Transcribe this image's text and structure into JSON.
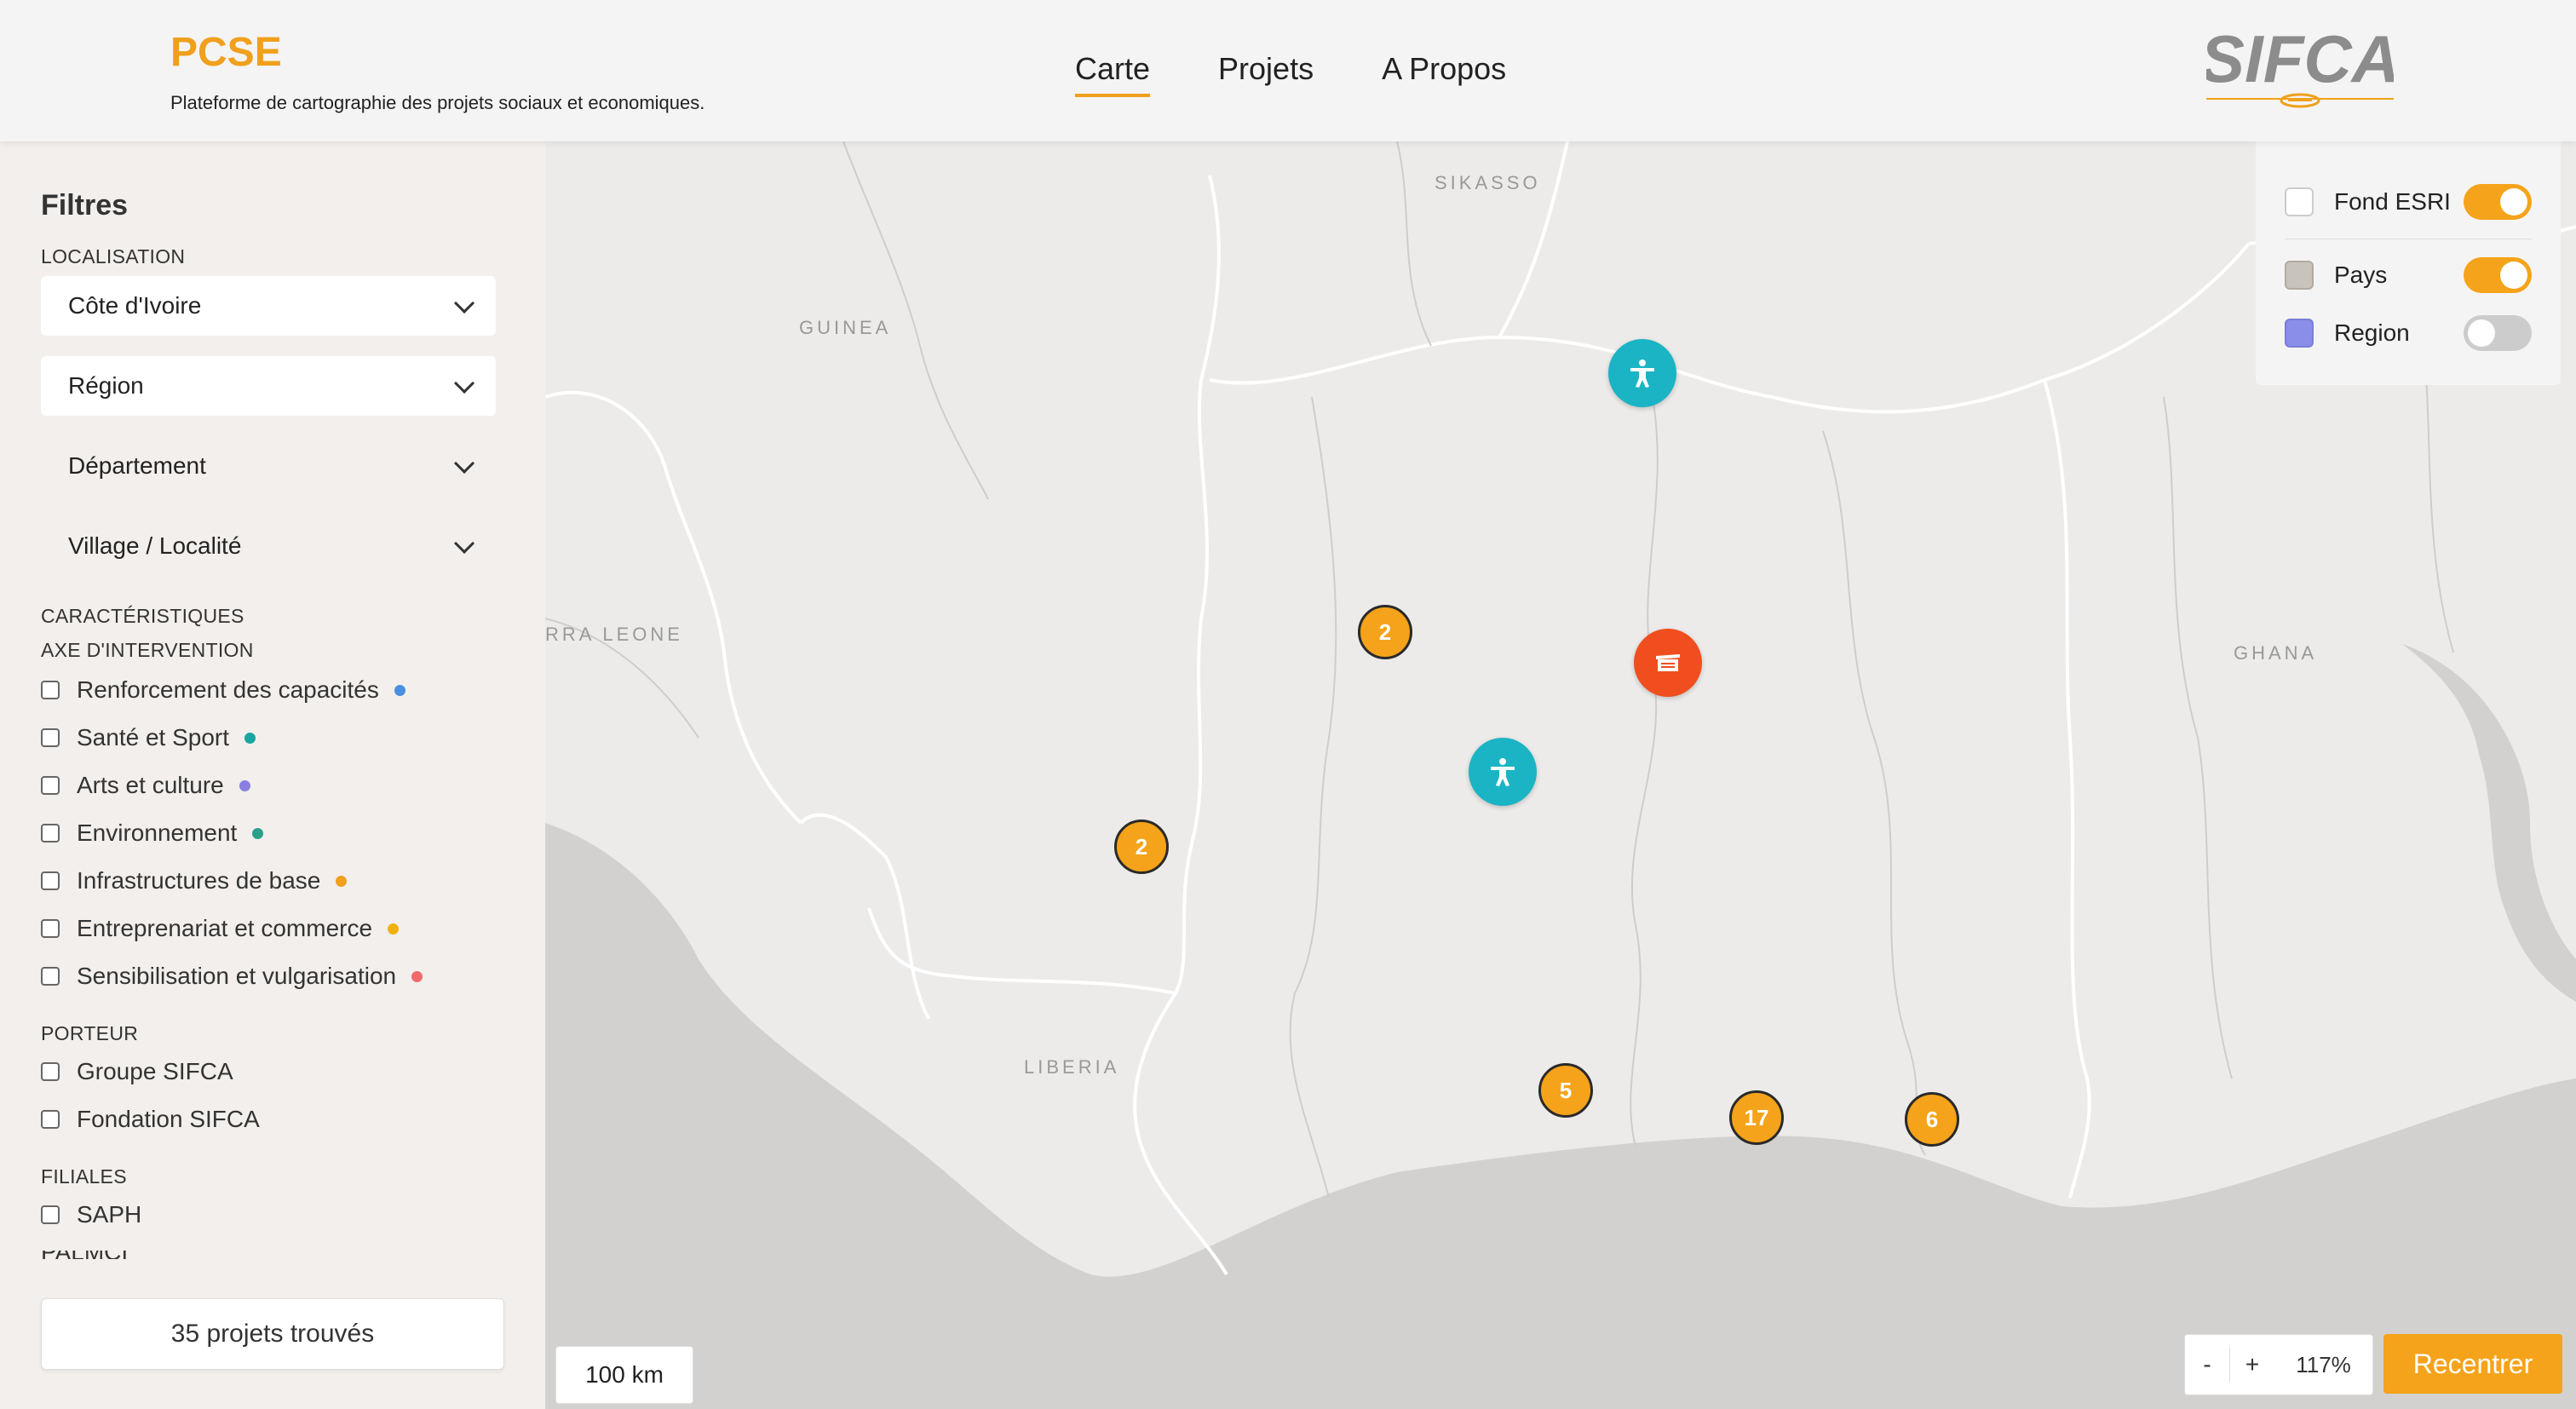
{
  "header": {
    "title": "PCSE",
    "subtitle": "Plateforme de cartographie des projets sociaux et economiques.",
    "nav": [
      {
        "label": "Carte",
        "active": true
      },
      {
        "label": "Projets",
        "active": false
      },
      {
        "label": "A Propos",
        "active": false
      }
    ],
    "logo_text": "SIFCA",
    "accent": "#f0a01c"
  },
  "sidebar": {
    "title": "Filtres",
    "localisation_label": "LOCALISATION",
    "selects": [
      {
        "value": "Côte d'Ivoire"
      },
      {
        "value": "Région"
      },
      {
        "value": "Département"
      },
      {
        "value": "Village / Localité"
      }
    ],
    "characteristics_label": "CARACTÉRISTIQUES",
    "axis_label": "AXE D'INTERVENTION",
    "axes": [
      {
        "label": "Renforcement des capacités",
        "color": "#4a8fe0"
      },
      {
        "label": "Santé et Sport",
        "color": "#1aa5a0"
      },
      {
        "label": "Arts et culture",
        "color": "#8a7fe0"
      },
      {
        "label": "Environnement",
        "color": "#2aa08a"
      },
      {
        "label": "Infrastructures de base",
        "color": "#f0a01c"
      },
      {
        "label": "Entreprenariat et commerce",
        "color": "#f0b010"
      },
      {
        "label": "Sensibilisation et vulgarisation",
        "color": "#f06a6a"
      }
    ],
    "porteur_label": "PORTEUR",
    "porteurs": [
      "Groupe SIFCA",
      "Fondation SIFCA"
    ],
    "filiales_label": "FILIALES",
    "filiales": [
      "SAPH",
      "PALMCI"
    ],
    "found": "35 projets trouvés"
  },
  "map": {
    "labels": [
      "SIKASSO",
      "GUINEA",
      "RRA LEONE",
      "LIBERIA",
      "GHANA"
    ],
    "clusters": [
      "2",
      "2",
      "5",
      "17",
      "6"
    ],
    "icon_markers": [
      "person-icon",
      "person-icon",
      "building-icon"
    ],
    "layers": [
      {
        "label": "Fond ESRI",
        "on": true,
        "swatch": "#ffffff"
      },
      {
        "label": "Pays",
        "on": true,
        "swatch": "#c9c4bb"
      },
      {
        "label": "Region",
        "on": false,
        "swatch": "#8a8ee8"
      }
    ],
    "scale": "100 km",
    "zoom_minus": "-",
    "zoom_plus": "+",
    "zoom_level": "117%",
    "recenter": "Recentrer"
  }
}
